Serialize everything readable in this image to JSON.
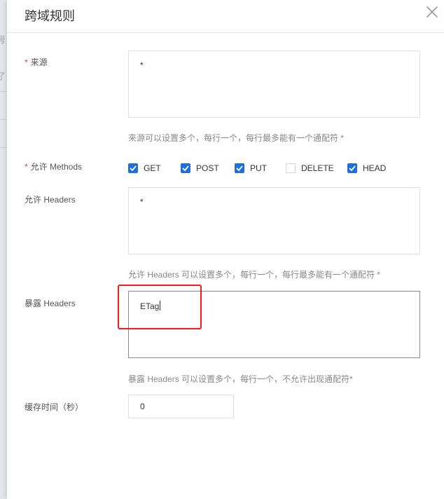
{
  "dialog": {
    "title": "跨域规则"
  },
  "backdrop": {
    "glyph_1": "号",
    "glyph_2": "了"
  },
  "form": {
    "origin": {
      "required_mark": "*",
      "label": "来源",
      "value": "*",
      "hint": "来源可以设置多个，每行一个，每行最多能有一个通配符 *"
    },
    "methods": {
      "required_mark": "*",
      "label": "允许 Methods",
      "options": [
        {
          "label": "GET",
          "checked": true
        },
        {
          "label": "POST",
          "checked": true
        },
        {
          "label": "PUT",
          "checked": true
        },
        {
          "label": "DELETE",
          "checked": false
        },
        {
          "label": "HEAD",
          "checked": true
        }
      ]
    },
    "allow_headers": {
      "label": "允许 Headers",
      "value": "*",
      "hint": "允许 Headers 可以设置多个，每行一个，每行最多能有一个通配符 *"
    },
    "expose_headers": {
      "label": "暴露 Headers",
      "value": "ETag",
      "hint": "暴露 Headers 可以设置多个，每行一个，不允许出现通配符*"
    },
    "cache_time": {
      "label": "缓存时间（秒）",
      "value": "0"
    }
  },
  "colors": {
    "accent": "#1e6fd9",
    "required": "#e4393c",
    "annotation": "#ff1a1a"
  }
}
